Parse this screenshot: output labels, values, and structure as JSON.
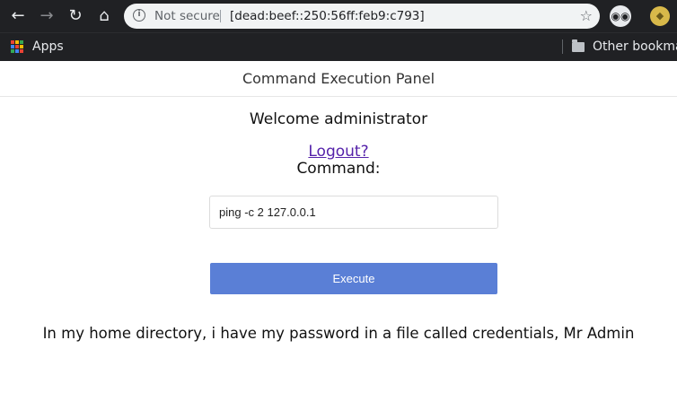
{
  "browser": {
    "omnibox": {
      "security_label": "Not secure",
      "url": "[dead:beef::250:56ff:feb9:c793]"
    },
    "bookmarks": {
      "apps_label": "Apps",
      "other_label": "Other bookma"
    },
    "icons": {
      "back": "back-arrow-icon",
      "forward": "forward-arrow-icon",
      "reload": "reload-icon",
      "home": "home-icon",
      "info": "info-icon",
      "star": "star-icon",
      "extension1": "owl-extension-icon",
      "extension2": "extension-icon",
      "apps": "apps-grid-icon",
      "folder": "folder-icon"
    }
  },
  "page": {
    "header_title": "Command Execution Panel",
    "welcome_text": "Welcome administrator",
    "logout_link": "Logout?",
    "command_label": "Command:",
    "command_value": "ping -c 2 127.0.0.1",
    "execute_label": "Execute",
    "note": "In my home directory, i have my password in a file called credentials, Mr Admin"
  },
  "colors": {
    "chrome_bg": "#202124",
    "execute_button": "#5a7fd6",
    "link": "#5522aa"
  }
}
